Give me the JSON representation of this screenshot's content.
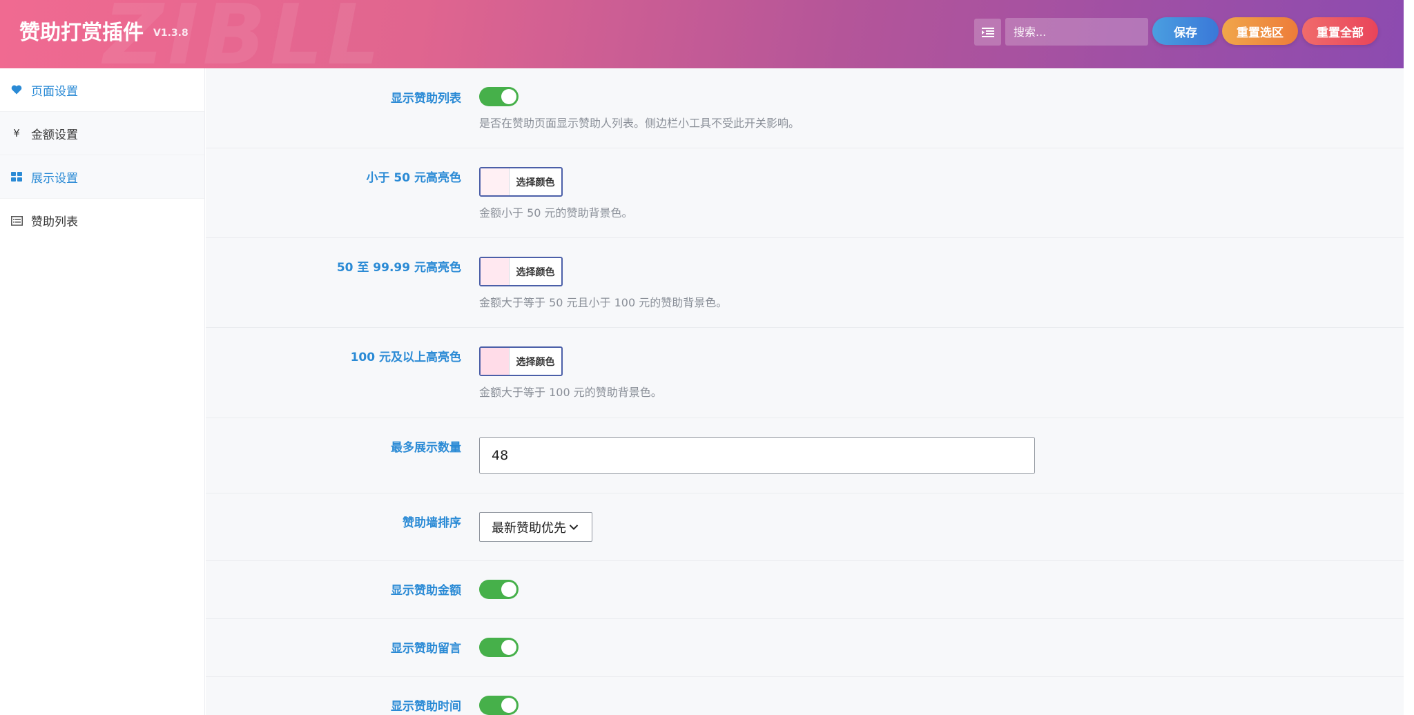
{
  "header": {
    "title": "赞助打赏插件",
    "version": "V1.3.8",
    "watermark": "ZIBLL",
    "search_placeholder": "搜索...",
    "save_label": "保存",
    "reset_section_label": "重置选区",
    "reset_all_label": "重置全部"
  },
  "sidebar": {
    "items": [
      {
        "label": "页面设置",
        "icon": "heart-icon"
      },
      {
        "label": "金额设置",
        "icon": "yen-icon"
      },
      {
        "label": "展示设置",
        "icon": "grid-icon"
      },
      {
        "label": "赞助列表",
        "icon": "list-icon"
      }
    ]
  },
  "settings": {
    "show_list": {
      "label": "显示赞助列表",
      "enabled": true,
      "desc": "是否在赞助页面显示赞助人列表。侧边栏小工具不受此开关影响。"
    },
    "color_low": {
      "label": "小于 50 元高亮色",
      "button": "选择颜色",
      "desc": "金额小于 50 元的赞助背景色。",
      "color": "#fff0f4"
    },
    "color_mid": {
      "label": "50 至 99.99 元高亮色",
      "button": "选择颜色",
      "desc": "金额大于等于 50 元且小于 100 元的赞助背景色。",
      "color": "#ffe8f0"
    },
    "color_high": {
      "label": "100 元及以上高亮色",
      "button": "选择颜色",
      "desc": "金额大于等于 100 元的赞助背景色。",
      "color": "#ffdce8"
    },
    "max_count": {
      "label": "最多展示数量",
      "value": "48"
    },
    "sort": {
      "label": "赞助墙排序",
      "value": "最新赞助优先"
    },
    "show_amount": {
      "label": "显示赞助金额",
      "enabled": true
    },
    "show_message": {
      "label": "显示赞助留言",
      "enabled": true
    },
    "show_time": {
      "label": "显示赞助时间",
      "enabled": true
    }
  },
  "colors": {
    "accent": "#2a8ad5",
    "toggle_on": "#46b04a"
  }
}
